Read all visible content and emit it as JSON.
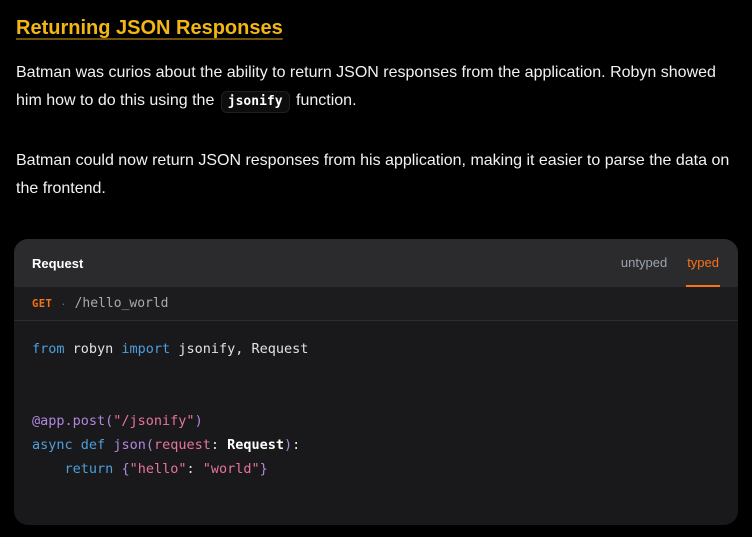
{
  "colors": {
    "background": "#000000",
    "text": "#f2f2f3",
    "heading": "#f2b713",
    "accent": "#f97316",
    "panel_bg": "#19191b",
    "header_bg": "#2b2b2d",
    "endpoint_bg": "#1c1c1e",
    "border": "rgba(255,255,255,0.08)",
    "tab_inactive": "#9ca3af",
    "path_text": "#a9a9b0",
    "token_plain": "#e2e2e6",
    "token_keyword": "#4d9fdb",
    "token_function": "#b287de",
    "token_string": "#e8739e",
    "token_type": "#ffffff"
  },
  "page": {
    "heading": "Returning JSON Responses",
    "intro": {
      "before_code": "Batman was curios about the ability to return JSON responses from the application. Robyn showed him how to do this using the ",
      "inline_code": "jsonify",
      "after_code": " function."
    },
    "para2": "Batman could now return JSON responses from his application, making it easier to parse the data on the frontend."
  },
  "code_panel": {
    "title": "Request",
    "tabs": [
      {
        "label": "untyped",
        "active": false
      },
      {
        "label": "typed",
        "active": true
      }
    ],
    "endpoint": {
      "method": "GET",
      "separator": "·",
      "path": "/hello_world"
    },
    "code": {
      "language": "python",
      "lines": [
        [
          {
            "c": "kw",
            "t": "from"
          },
          {
            "c": "plain",
            "t": " robyn "
          },
          {
            "c": "kw",
            "t": "import"
          },
          {
            "c": "plain",
            "t": " jsonify, Request"
          }
        ],
        [],
        [],
        [
          {
            "c": "fn",
            "t": "@app.post("
          },
          {
            "c": "str",
            "t": "\"/jsonify\""
          },
          {
            "c": "fn",
            "t": ")"
          }
        ],
        [
          {
            "c": "kw",
            "t": "async"
          },
          {
            "c": "plain",
            "t": " "
          },
          {
            "c": "kw",
            "t": "def"
          },
          {
            "c": "plain",
            "t": " "
          },
          {
            "c": "fn",
            "t": "json("
          },
          {
            "c": "str",
            "t": "request"
          },
          {
            "c": "plain",
            "t": ": "
          },
          {
            "c": "type",
            "t": "Request"
          },
          {
            "c": "fn",
            "t": ")"
          },
          {
            "c": "plain",
            "t": ":"
          }
        ],
        [
          {
            "c": "plain",
            "t": "    "
          },
          {
            "c": "kw",
            "t": "return"
          },
          {
            "c": "plain",
            "t": " "
          },
          {
            "c": "fn",
            "t": "{"
          },
          {
            "c": "str",
            "t": "\"hello\""
          },
          {
            "c": "plain",
            "t": ": "
          },
          {
            "c": "str",
            "t": "\"world\""
          },
          {
            "c": "fn",
            "t": "}"
          }
        ]
      ]
    }
  }
}
